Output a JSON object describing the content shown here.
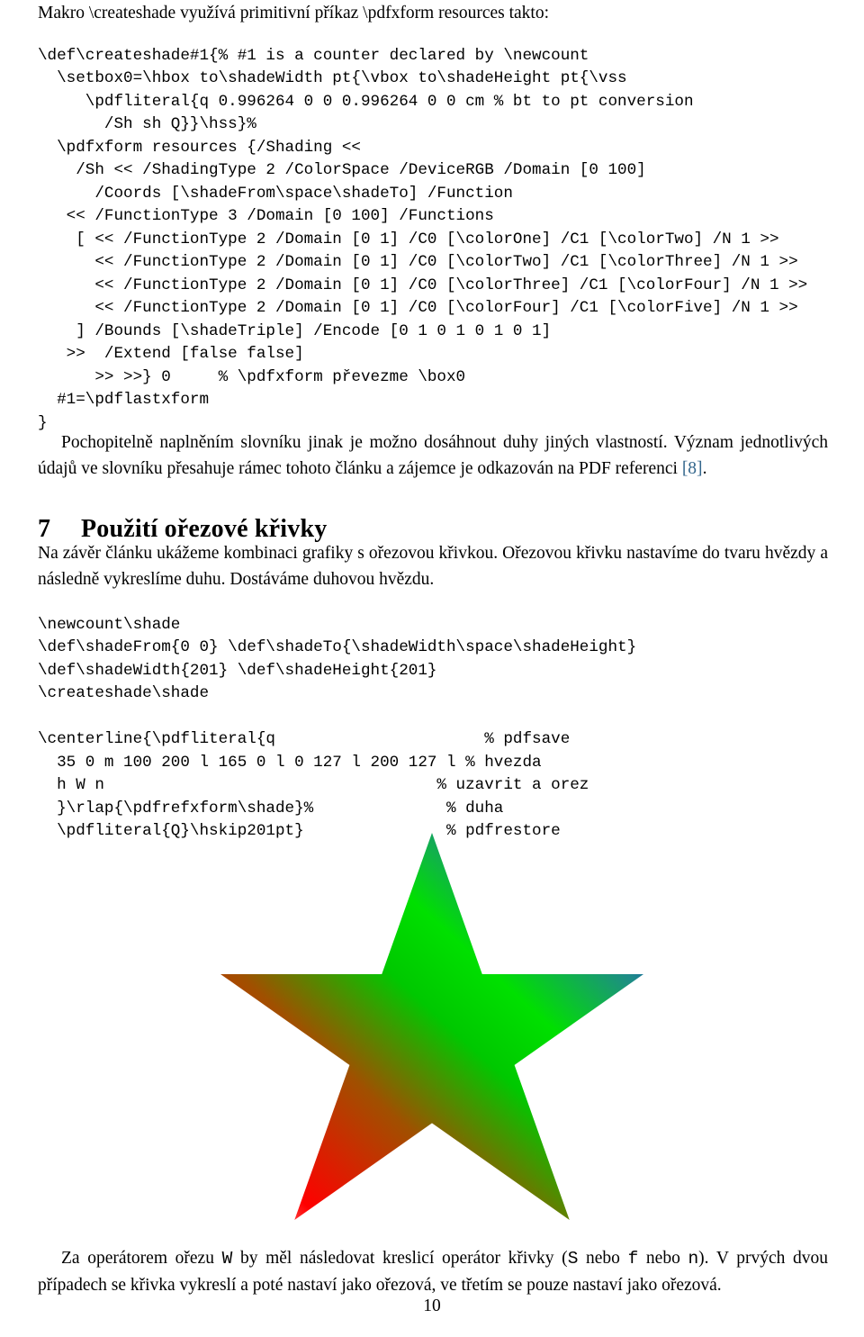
{
  "document": {
    "intro_text": "Makro \\createshade využívá primitivní příkaz \\pdfxform resources takto:",
    "page_number": "10"
  },
  "code_createshade": {
    "name": "createshade-macro-listing",
    "lines": [
      "\\def\\createshade#1{% #1 is a counter declared by \\newcount",
      "  \\setbox0=\\hbox to\\shadeWidth pt{\\vbox to\\shadeHeight pt{\\vss",
      "     \\pdfliteral{q 0.996264 0 0 0.996264 0 0 cm % bt to pt conversion",
      "       /Sh sh Q}}\\hss}%",
      "  \\pdfxform resources {/Shading <<",
      "    /Sh << /ShadingType 2 /ColorSpace /DeviceRGB /Domain [0 100]",
      "      /Coords [\\shadeFrom\\space\\shadeTo] /Function",
      "   << /FunctionType 3 /Domain [0 100] /Functions",
      "    [ << /FunctionType 2 /Domain [0 1] /C0 [\\colorOne] /C1 [\\colorTwo] /N 1 >>",
      "      << /FunctionType 2 /Domain [0 1] /C0 [\\colorTwo] /C1 [\\colorThree] /N 1 >>",
      "      << /FunctionType 2 /Domain [0 1] /C0 [\\colorThree] /C1 [\\colorFour] /N 1 >>",
      "      << /FunctionType 2 /Domain [0 1] /C0 [\\colorFour] /C1 [\\colorFive] /N 1 >>",
      "    ] /Bounds [\\shadeTriple] /Encode [0 1 0 1 0 1 0 1]",
      "   >>  /Extend [false false]",
      "      >> >>} 0     % \\pdfxform převezme \\box0",
      "  #1=\\pdflastxform",
      "}"
    ]
  },
  "paragraph_dictionary": {
    "name": "dictionary-paragraph",
    "text_before_ref": "Pochopitelně naplněním slovníku jinak je možno dosáhnout duhy jiných vlastností. Význam jednotlivých údajů ve slovníku přesahuje rámec tohoto článku a zájemce je odkazován na PDF referenci ",
    "reference": "[8]",
    "text_after_ref": "."
  },
  "section": {
    "number": "7",
    "title": "Použití ořezové křivky",
    "paragraph": "Na závěr článku ukážeme kombinaci grafiky s ořezovou křivkou. Ořezovou křivku nastavíme do tvaru hvězdy a následně vykreslíme duhu. Dostáváme duhovou hvězdu."
  },
  "code_star": {
    "name": "star-clip-listing",
    "lines": [
      "\\newcount\\shade",
      "\\def\\shadeFrom{0 0} \\def\\shadeTo{\\shadeWidth\\space\\shadeHeight}",
      "\\def\\shadeWidth{201} \\def\\shadeHeight{201}",
      "\\createshade\\shade",
      "",
      "\\centerline{\\pdfliteral{q                      % pdfsave",
      "  35 0 m 100 200 l 165 0 l 0 127 l 200 127 l % hvezda",
      "  h W n                                   % uzavrit a orez",
      "  }\\rlap{\\pdfrefxform\\shade}%              % duha",
      "  \\pdfliteral{Q}\\hskip201pt}               % pdfrestore"
    ]
  },
  "figure_star": {
    "name": "rainbow-star-figure",
    "caption": "",
    "gradient_stops": [
      {
        "offset": "0%",
        "color": "#ffc0c0"
      },
      {
        "offset": "12%",
        "color": "#ff0000"
      },
      {
        "offset": "34%",
        "color": "#a05000"
      },
      {
        "offset": "52%",
        "color": "#00c800"
      },
      {
        "offset": "64%",
        "color": "#00e000"
      },
      {
        "offset": "80%",
        "color": "#1e8a8a"
      },
      {
        "offset": "92%",
        "color": "#0000e0"
      },
      {
        "offset": "100%",
        "color": "#000080"
      }
    ],
    "star_points": "35 0, 100 200, 165 0, 0 127, 200 127"
  },
  "paragraph_final": {
    "name": "clip-operator-paragraph",
    "segments": [
      {
        "text": "Za operátorem ořezu ",
        "mono": false
      },
      {
        "text": "W",
        "mono": true
      },
      {
        "text": " by měl následovat kreslicí operátor křivky (",
        "mono": false
      },
      {
        "text": "S",
        "mono": true
      },
      {
        "text": " nebo ",
        "mono": false
      },
      {
        "text": "f",
        "mono": true
      },
      {
        "text": " nebo ",
        "mono": false
      },
      {
        "text": "n",
        "mono": true
      },
      {
        "text": "). V prvých dvou případech se křivka vykreslí a poté nastaví jako ořezová, ve třetím se pouze nastaví jako ořezová.",
        "mono": false
      }
    ]
  },
  "colors": {
    "text": "#000000",
    "reference_link": "#33668c",
    "background": "#ffffff"
  }
}
